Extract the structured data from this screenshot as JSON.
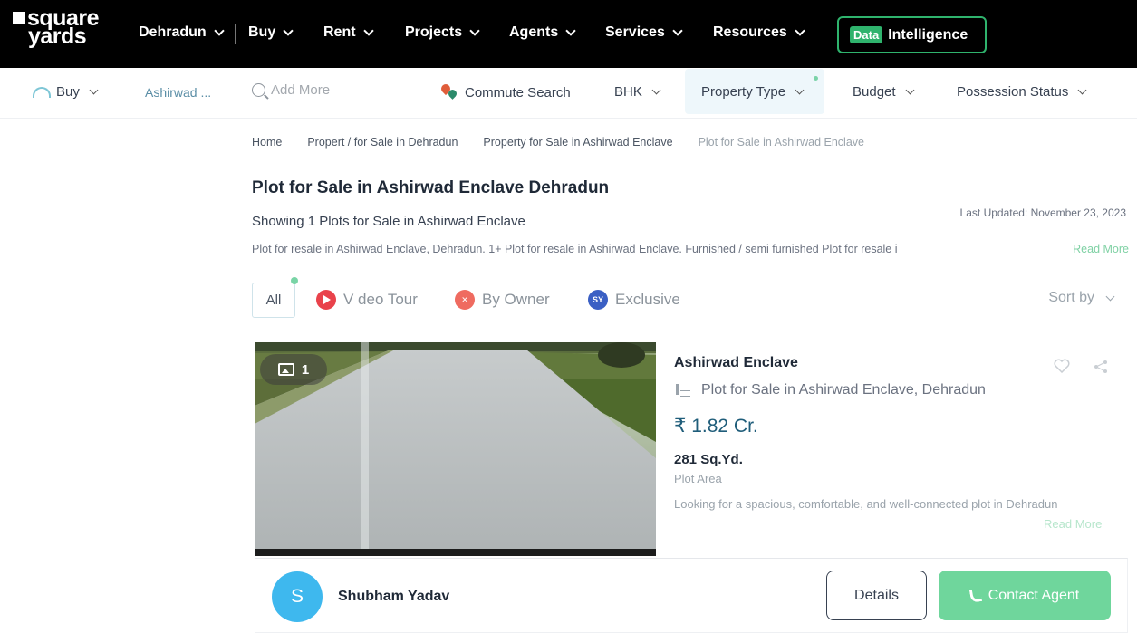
{
  "nav": {
    "logo_line1": "square",
    "logo_line2": "yards",
    "city": "Dehradun",
    "items": [
      "Buy",
      "Rent",
      "Projects",
      "Agents",
      "Services",
      "Resources"
    ],
    "data_badge": "Data",
    "intelligence": "Intelligence"
  },
  "filters": {
    "buy": "Buy",
    "location_chip": "Ashirwad ...",
    "search_placeholder": "Add More",
    "commute": "Commute Search",
    "bhk": "BHK",
    "property_type": "Property Type",
    "budget": "Budget",
    "possession": "Possession Status"
  },
  "breadcrumb": [
    "Home",
    "Propert / for Sale in Dehradun",
    "Property for Sale in Ashirwad Enclave",
    "Plot for Sale in Ashirwad Enclave"
  ],
  "page": {
    "title": "Plot for Sale in Ashirwad Enclave Dehradun",
    "showing": "Showing 1 Plots for Sale in Ashirwad Enclave",
    "last_updated": "Last Updated: November 23, 2023",
    "description": "Plot for resale in Ashirwad Enclave, Dehradun. 1+ Plot for resale in Ashirwad Enclave. Furnished / semi furnished Plot for resale i",
    "read_more": "Read More"
  },
  "chips": {
    "all": "All",
    "video_tour": "V deo Tour",
    "by_owner": "By Owner",
    "exclusive": "Exclusive",
    "exclusive_badge": "SY",
    "sort_by": "Sort by"
  },
  "listing": {
    "image_count": "1",
    "name": "Ashirwad Enclave",
    "type": "Plot for Sale in Ashirwad Enclave, Dehradun",
    "price": "₹ 1.82 Cr.",
    "area": "281 Sq.Yd.",
    "area_label": "Plot Area",
    "description": "Looking for a spacious, comfortable, and well-connected plot in Dehradun",
    "read_more": "Read More",
    "agent_initial": "S",
    "agent_name": "Shubham Yadav",
    "details_button": "Details",
    "contact_button": "Contact Agent"
  },
  "colors": {
    "nav_bg": "#000000",
    "accent_green": "#2fb36d",
    "contact_button": "#6fd69c",
    "price": "#1f5d7a",
    "avatar": "#3eb8ee",
    "video_icon": "#e9424b",
    "owner_icon": "#ef6b60",
    "exclusive_icon": "#3a5fc4"
  }
}
